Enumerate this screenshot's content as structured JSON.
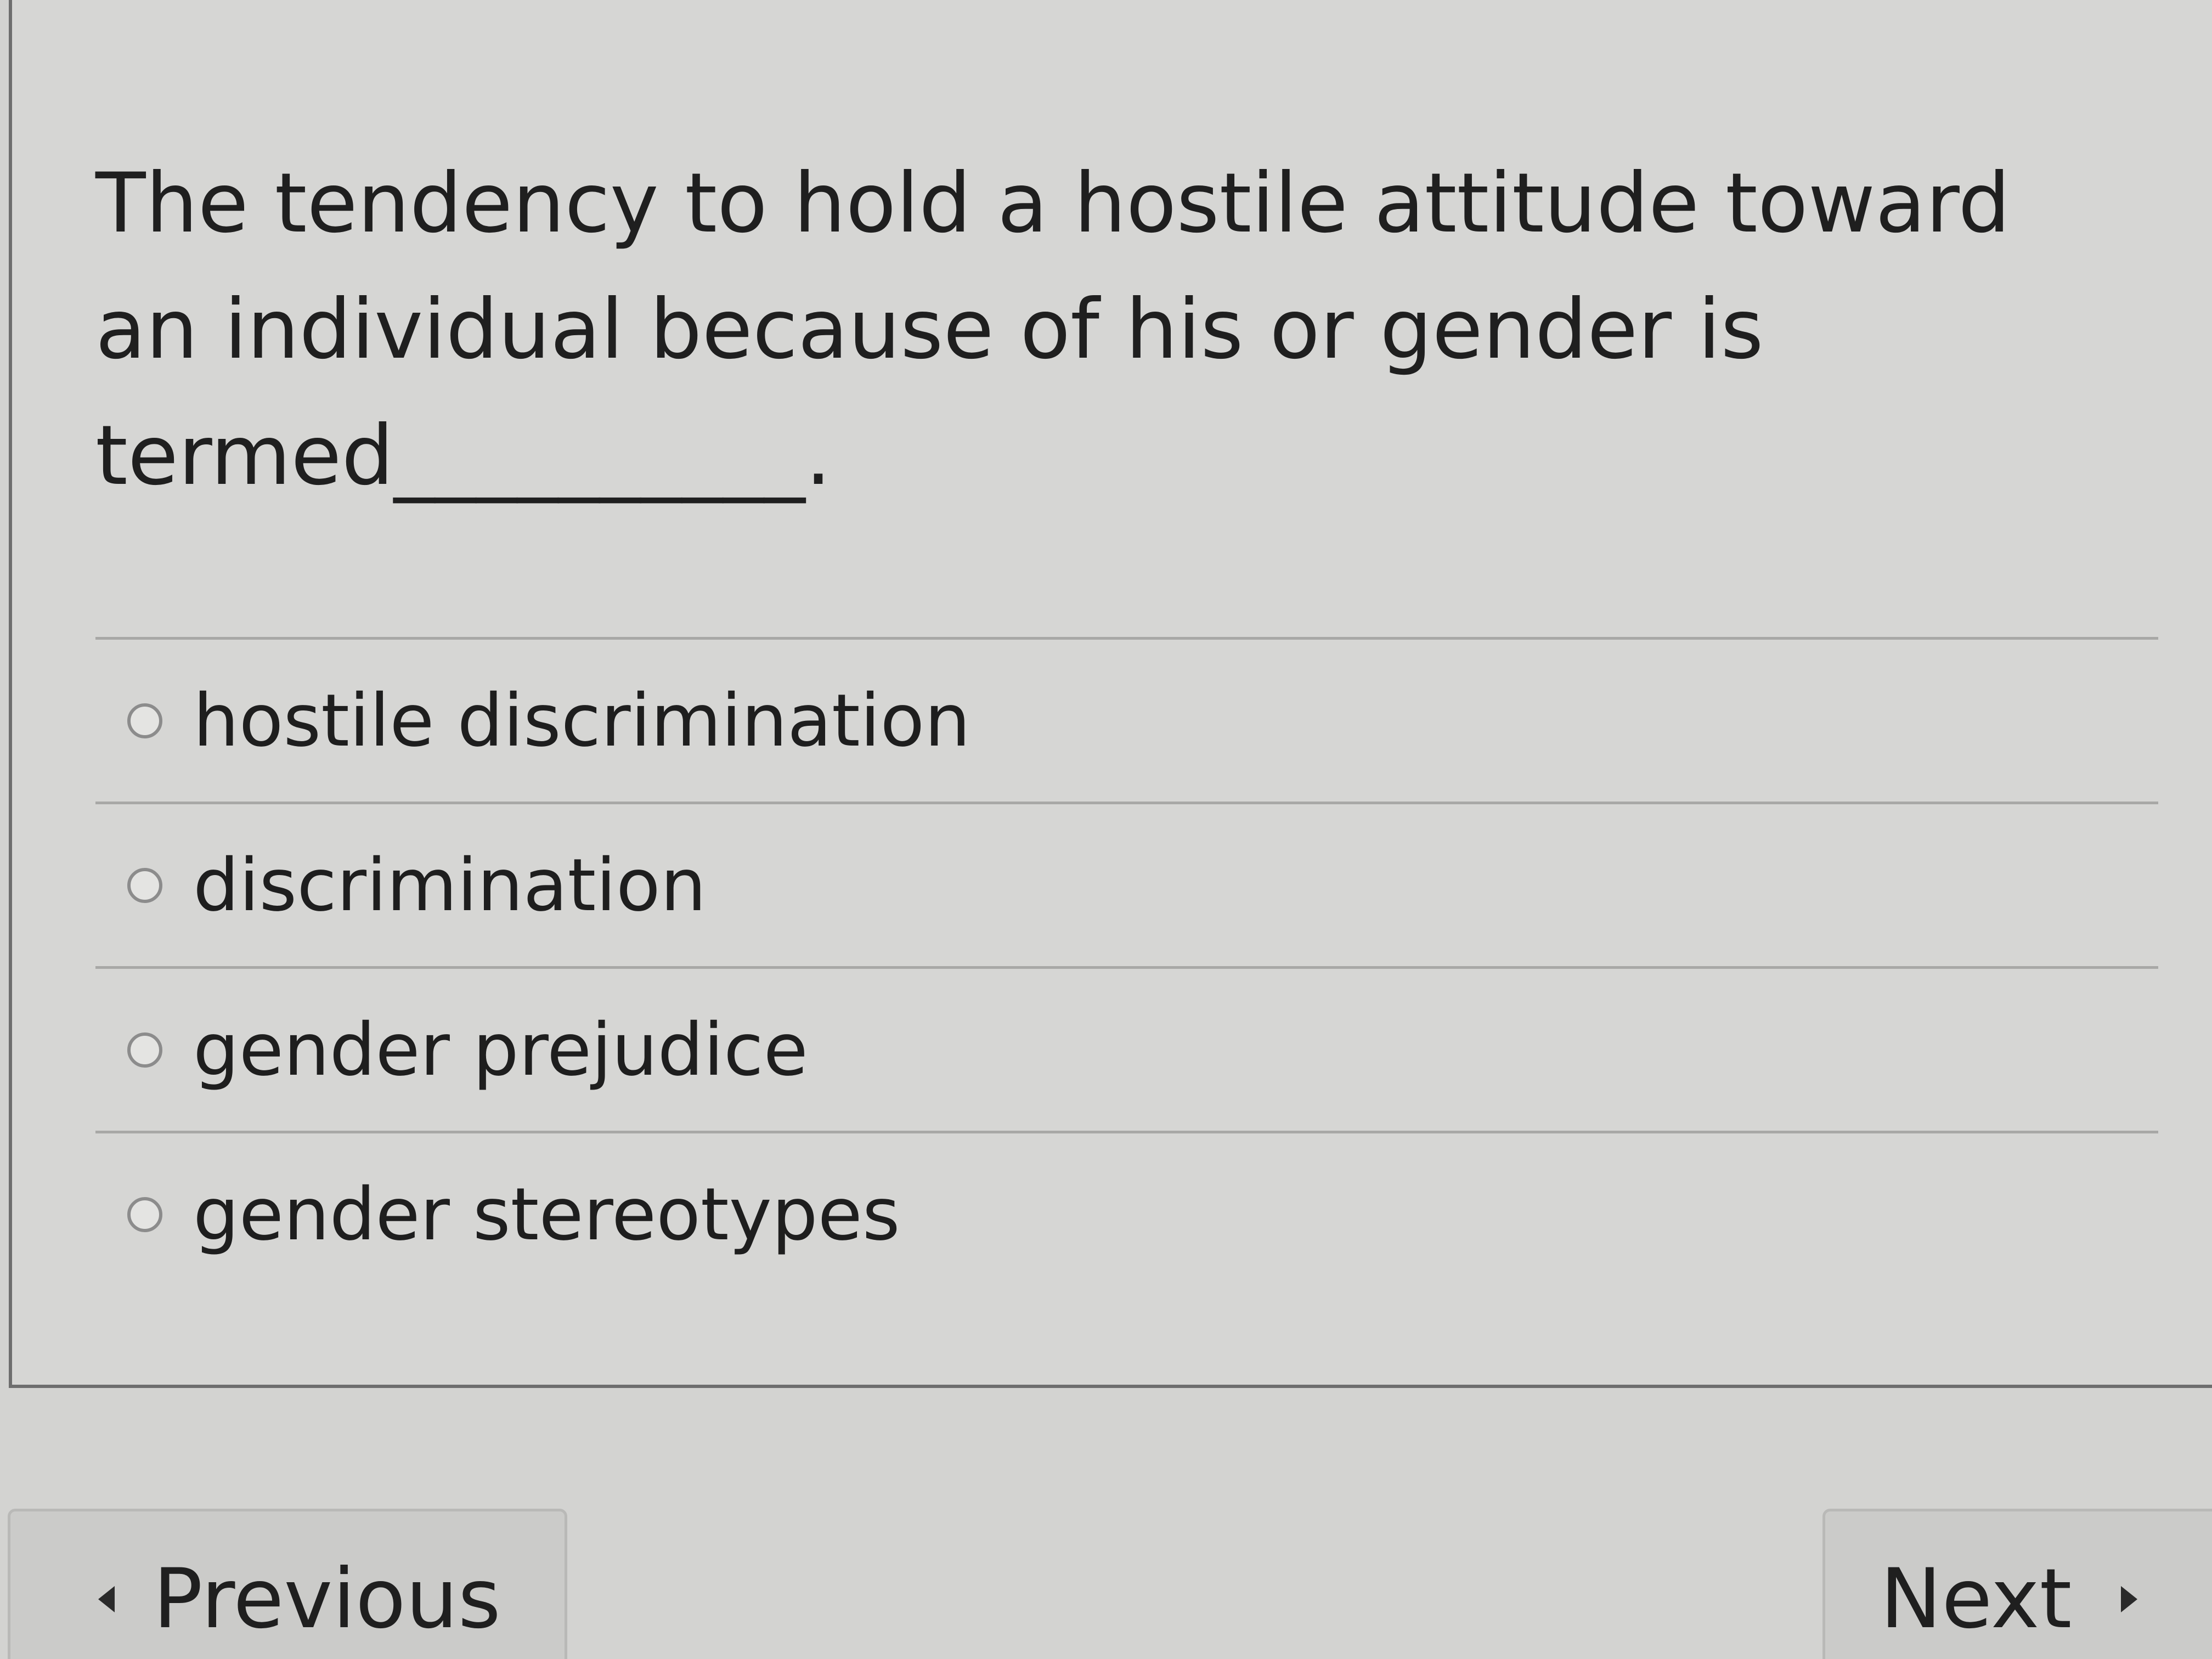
{
  "question": {
    "text": "The tendency to hold a hostile attitude toward an individual because of his or gender is termed__________."
  },
  "answers": [
    {
      "label": "hostile discrimination",
      "selected": false
    },
    {
      "label": "discrimination",
      "selected": false
    },
    {
      "label": "gender prejudice",
      "selected": false
    },
    {
      "label": "gender stereotypes",
      "selected": false
    }
  ],
  "navigation": {
    "previous_label": "Previous",
    "next_label": "Next",
    "previous_icon": "triangle-left-icon",
    "next_icon": "triangle-right-icon"
  }
}
